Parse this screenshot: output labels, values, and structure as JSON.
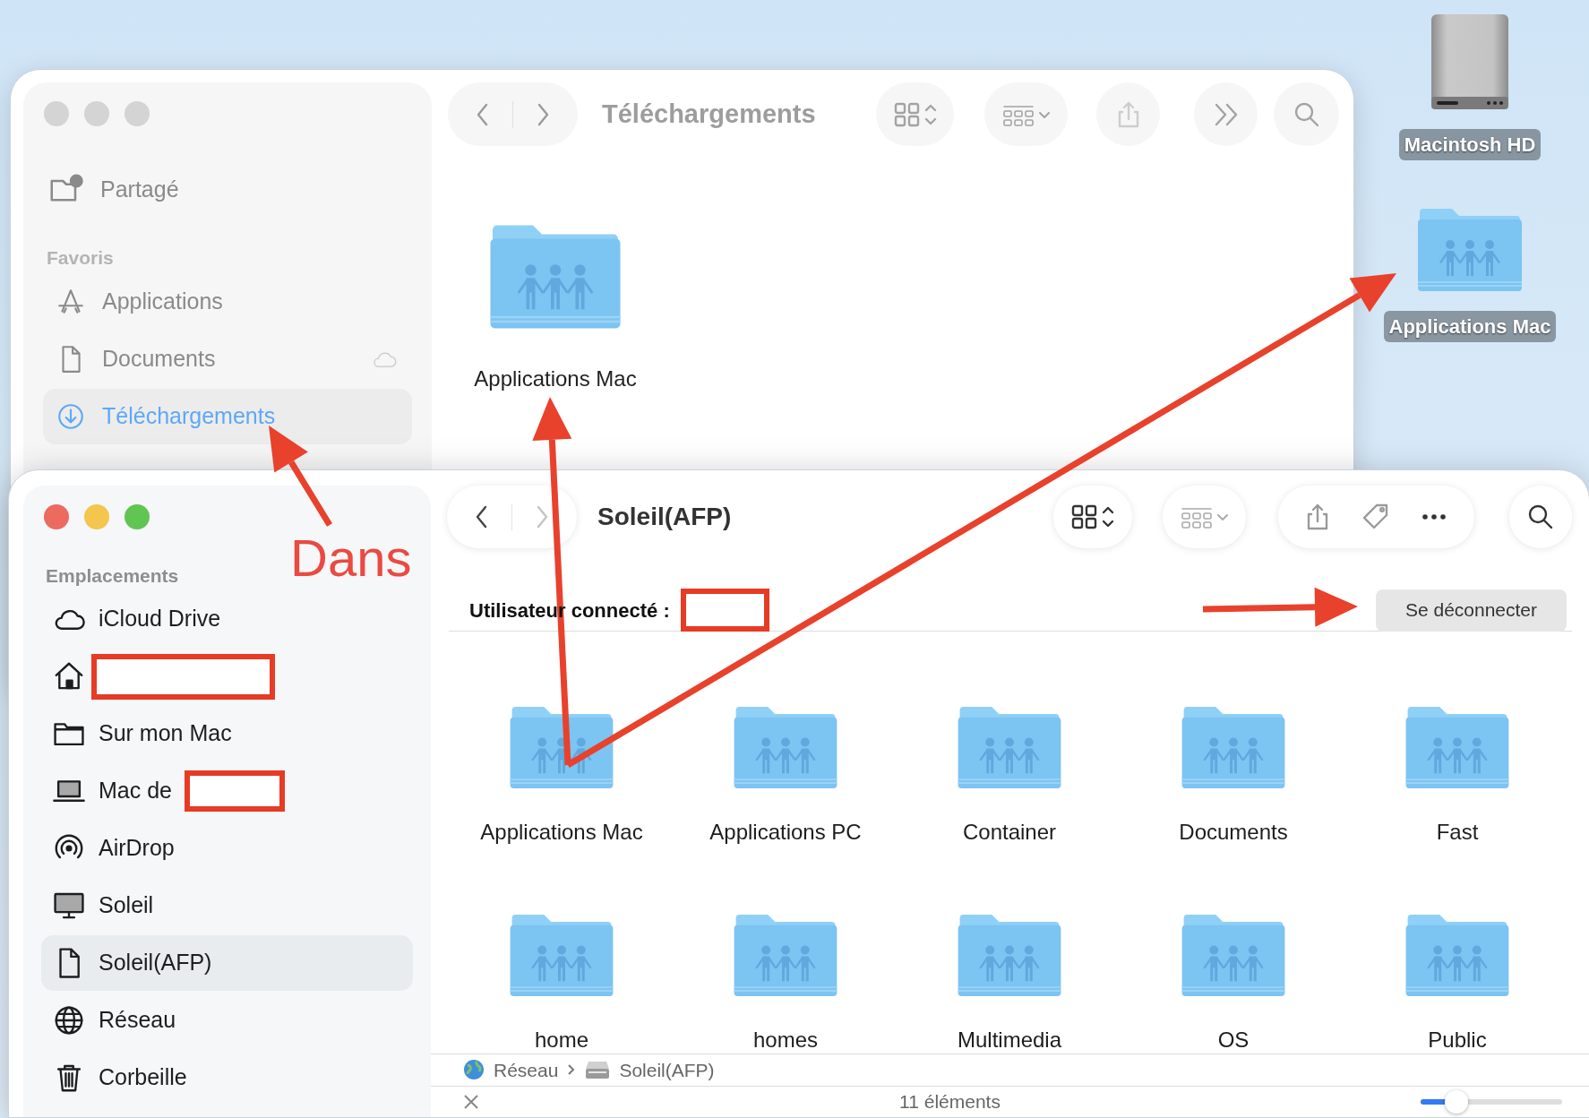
{
  "desktop": {
    "icons": [
      {
        "label": "Macintosh HD",
        "kind": "drive"
      },
      {
        "label": "Applications Mac",
        "kind": "shared-folder"
      }
    ]
  },
  "back_window": {
    "sidebar": {
      "top_items": [
        {
          "label": "Partagé",
          "kind": "shared"
        }
      ],
      "section": "Favoris",
      "items": [
        {
          "label": "Applications",
          "kind": "apps",
          "selected": false,
          "icloud": false
        },
        {
          "label": "Documents",
          "kind": "doc",
          "selected": false,
          "icloud": true
        },
        {
          "label": "Téléchargements",
          "kind": "download",
          "selected": true,
          "icloud": false
        }
      ]
    },
    "toolbar": {
      "title": "Téléchargements"
    },
    "files": [
      {
        "label": "Applications Mac"
      }
    ]
  },
  "front_window": {
    "sidebar": {
      "section": "Emplacements",
      "items": [
        {
          "label": "iCloud Drive",
          "kind": "cloud",
          "selected": false,
          "redacted": false
        },
        {
          "kind": "home",
          "selected": false,
          "redacted": true
        },
        {
          "label": "Sur mon Mac",
          "kind": "folder",
          "selected": false,
          "redacted": false
        },
        {
          "label": "Mac de",
          "kind": "laptop",
          "selected": false,
          "redacted": true
        },
        {
          "label": "AirDrop",
          "kind": "airdrop",
          "selected": false,
          "redacted": false
        },
        {
          "label": "Soleil",
          "kind": "display",
          "selected": false,
          "redacted": false
        },
        {
          "label": "Soleil(AFP)",
          "kind": "doc",
          "selected": true,
          "redacted": false
        },
        {
          "label": "Réseau",
          "kind": "globe",
          "selected": false,
          "redacted": false
        },
        {
          "label": "Corbeille",
          "kind": "trash",
          "selected": false,
          "redacted": false
        }
      ]
    },
    "toolbar": {
      "title": "Soleil(AFP)"
    },
    "user": {
      "label": "Utilisateur connecté :",
      "redacted": true
    },
    "disconnect_button": "Se déconnecter",
    "files": [
      {
        "label": "Applications Mac"
      },
      {
        "label": "Applications PC"
      },
      {
        "label": "Container"
      },
      {
        "label": "Documents"
      },
      {
        "label": "Fast"
      },
      {
        "label": "home"
      },
      {
        "label": "homes"
      },
      {
        "label": "Multimedia"
      },
      {
        "label": "OS"
      },
      {
        "label": "Public"
      }
    ],
    "path": [
      {
        "label": "Réseau",
        "kind": "globe"
      },
      {
        "label": "Soleil(AFP)",
        "kind": "drive"
      }
    ],
    "status": "11 éléments",
    "icon_size": {
      "level": 0.25
    }
  },
  "annotations": {
    "label": "Dans"
  }
}
